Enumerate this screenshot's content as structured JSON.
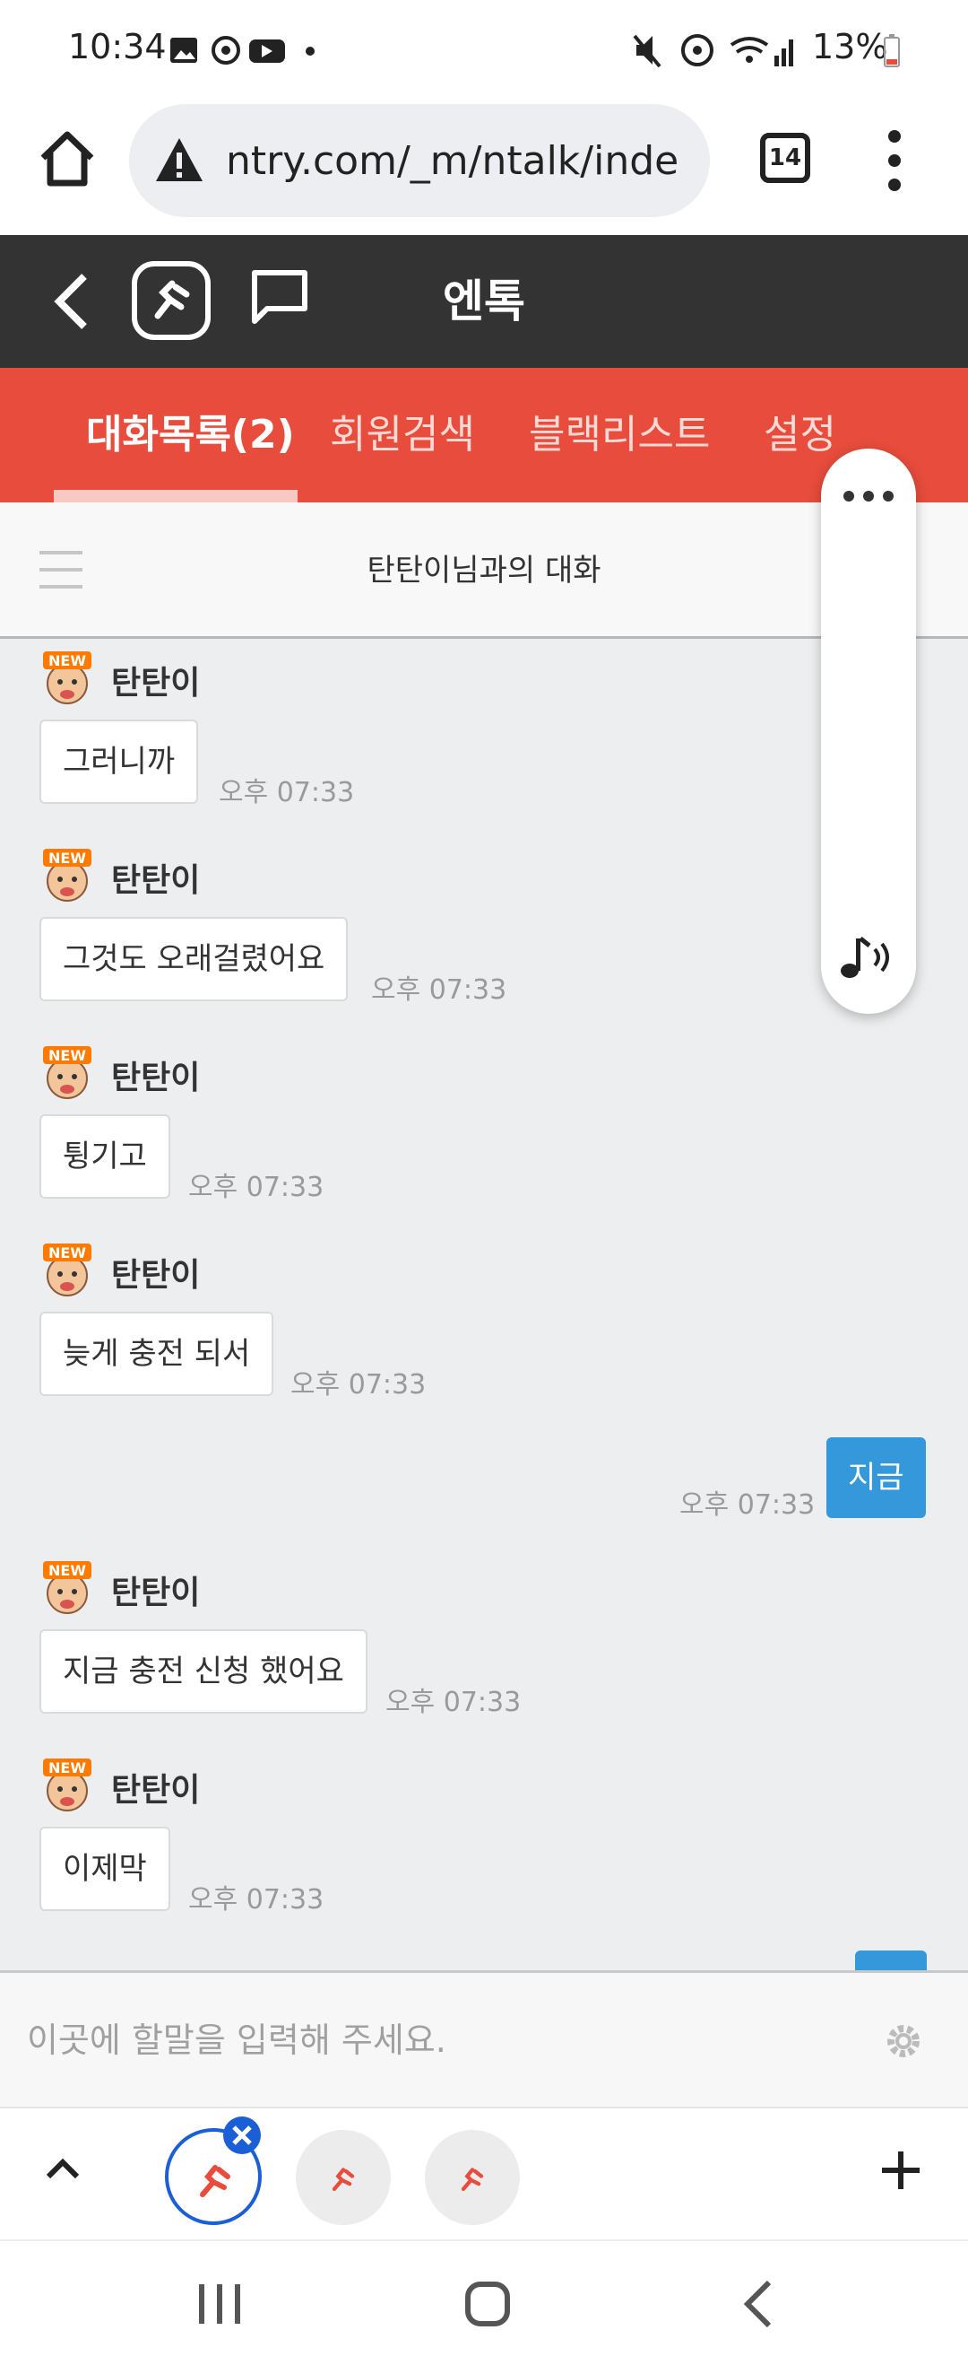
{
  "status_bar": {
    "time": "10:34",
    "battery": "13%"
  },
  "browser": {
    "url": "ntry.com/_m/ntalk/inde",
    "tab_count": "14"
  },
  "app": {
    "title": "엔톡"
  },
  "tabs": [
    {
      "label": "대화목록(2)",
      "active": true
    },
    {
      "label": "회원검색"
    },
    {
      "label": "블랙리스트"
    },
    {
      "label": "설정"
    }
  ],
  "chat": {
    "title": "탄탄이님과의 대화"
  },
  "messages": [
    {
      "sender": "탄탄이",
      "text": "그러니까",
      "time": "오후 07:33"
    },
    {
      "sender": "탄탄이",
      "text": "그것도 오래걸렸어요",
      "time": "오후 07:33"
    },
    {
      "sender": "탄탄이",
      "text": "튕기고",
      "time": "오후 07:33"
    },
    {
      "sender": "탄탄이",
      "text": "늦게 충전 되서",
      "time": "오후 07:33"
    },
    {
      "sender": "me",
      "text": "지금",
      "time": "오후 07:33"
    },
    {
      "sender": "탄탄이",
      "text": "지금 충전 신청 했어요",
      "time": "오후 07:33"
    },
    {
      "sender": "탄탄이",
      "text": "이제막",
      "time": "오후 07:33"
    }
  ],
  "avatar_badge": "NEW",
  "input": {
    "placeholder": "이곳에 할말을 입력해 주세요."
  },
  "colors": {
    "header": "#333333",
    "tabbar": "#e74c3c",
    "my_bubble": "#3498db"
  }
}
